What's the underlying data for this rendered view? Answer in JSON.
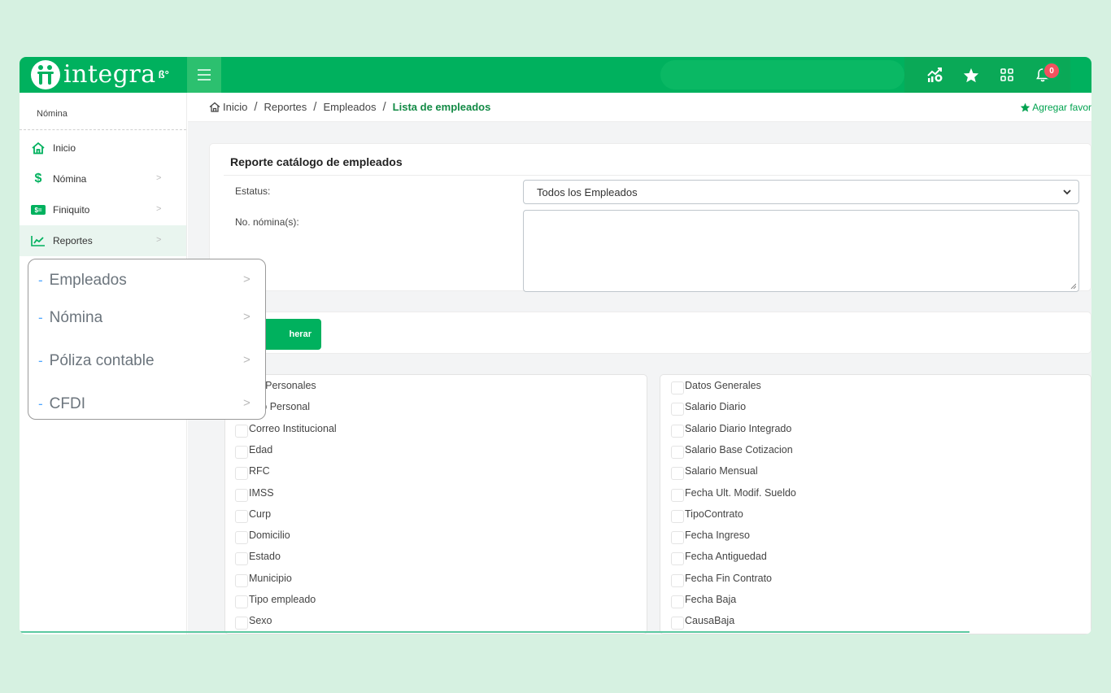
{
  "app": {
    "brand_name": "integra",
    "brand_mark": "ß°"
  },
  "topbar": {
    "icons": [
      "chart-growth-icon",
      "star-icon",
      "apps-grid-icon",
      "bell-icon"
    ],
    "notification_count": "0"
  },
  "sidebar": {
    "header": "Nómina",
    "items": [
      {
        "label": "Inicio",
        "icon": "home-icon"
      },
      {
        "label": "Nómina",
        "icon": "dollar-icon"
      },
      {
        "label": "Finiquito",
        "icon": "finiquito-icon"
      },
      {
        "label": "Reportes",
        "icon": "chart-line-icon"
      }
    ]
  },
  "submenu": {
    "items": [
      "Empleados",
      "Nómina",
      "Póliza contable",
      "CFDI"
    ]
  },
  "breadcrumb": {
    "home": "Inicio",
    "items": [
      "Reportes",
      "Empleados"
    ],
    "current": "Lista de empleados",
    "favorite_label": "Agregar favor"
  },
  "report": {
    "title": "Reporte catálogo de empleados",
    "status_label": "Estatus:",
    "status_value": "Todos los Empleados",
    "payroll_label": "No. nómina(s):",
    "payroll_value": "",
    "generate_button": "herar"
  },
  "columns": {
    "left": [
      "tos Personales",
      "rreo Personal",
      "Correo Institucional",
      "Edad",
      "RFC",
      "IMSS",
      "Curp",
      "Domicilio",
      "Estado",
      "Municipio",
      "Tipo empleado",
      "Sexo"
    ],
    "right": [
      "Datos Generales",
      "Salario Diario",
      "Salario Diario Integrado",
      "Salario Base Cotizacion",
      "Salario Mensual",
      "Fecha Ult. Modif. Sueldo",
      "TipoContrato",
      "Fecha Ingreso",
      "Fecha Antiguedad",
      "Fecha Fin Contrato",
      "Fecha Baja",
      "CausaBaja"
    ]
  },
  "colors": {
    "brand_green": "#00b15e",
    "background": "#d6f1e1",
    "badge_red": "#f2525f",
    "accent_blue": "#4da6ff"
  }
}
